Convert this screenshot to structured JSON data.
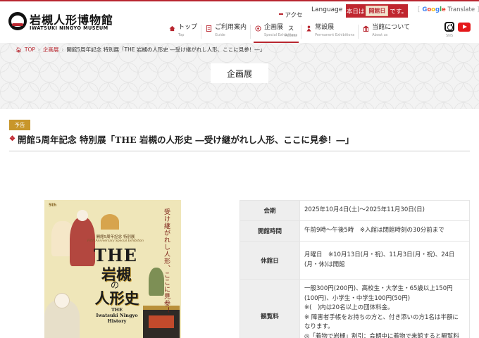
{
  "header": {
    "logo_ja": "岩槻人形博物館",
    "logo_en": "IWATSUKI NINGYO MUSEUM",
    "access_ja": "アクセス",
    "access_en": "Access",
    "language": "Language",
    "open_prefix": "本日は",
    "open_status": "開館日",
    "open_suffix": "です。",
    "translate_brand": "Google",
    "translate_label": "Translate",
    "sns_label": "SNS"
  },
  "nav": [
    {
      "ja": "トップ",
      "en": "Top",
      "icon": "home-icon"
    },
    {
      "ja": "ご利用案内",
      "en": "Guide",
      "icon": "document-icon"
    },
    {
      "ja": "企画展",
      "en": "Special Exhibitions",
      "icon": "flower-icon",
      "active": true
    },
    {
      "ja": "常設展",
      "en": "Permanent Exhibitions",
      "icon": "doll-icon"
    },
    {
      "ja": "当館について",
      "en": "About us",
      "icon": "building-icon"
    }
  ],
  "breadcrumb": {
    "home": "TOP",
    "section": "企画展",
    "current": "開館5周年記念 特別展「THE 岩槻の人形史 ―受け継がれし人形、ここに見参！―」"
  },
  "hero_title": "企画展",
  "badge": "予告",
  "heading": "開館5周年記念 特別展「THE 岩槻の人形史 ―受け継がれし人形、ここに見参！―」",
  "poster": {
    "anniversary_mark": "5th",
    "vertical_text": "受け継がれし人形、ここに見参！",
    "subtitle": "開館5周年記念 特別展",
    "subtitle_en": "Fifth Anniversary Special Exhibition",
    "the": "THE",
    "title_1": "岩槻",
    "title_no": "の",
    "title_2": "人形史",
    "title_en_1": "THE",
    "title_en_2": "Iwatsuki Ningyo",
    "title_en_3": "History"
  },
  "info": {
    "period_label": "会期",
    "period_value": "2025年10月4日(土)～2025年11月30日(日)",
    "hours_label": "開館時間",
    "hours_value": "午前9時～午後5時　※入館は閉館時刻の30分前まで",
    "closed_label": "休館日",
    "closed_value": "月曜日　※10月13日(月・祝)、11月3日(月・祝)、24日(月・休)は開館",
    "fee_label": "観覧料",
    "fee_line_1": "一般300円(200円)、高校生・大学生・65歳以上150円(100円)、小学生・中学生100円(50円)",
    "fee_line_2": "※(　)内は20名以上の団体料金。",
    "fee_line_3": "※ 障害者手帳をお持ちの方と、付き添いの方1名は半額になります。",
    "fee_line_4": "◎「着物で岩槻」割引：会期中に着物で来館すると観覧料が無"
  },
  "colors": {
    "brand_red": "#b8262f",
    "badge_gold": "#c8962b",
    "table_header": "#eeeeee"
  }
}
